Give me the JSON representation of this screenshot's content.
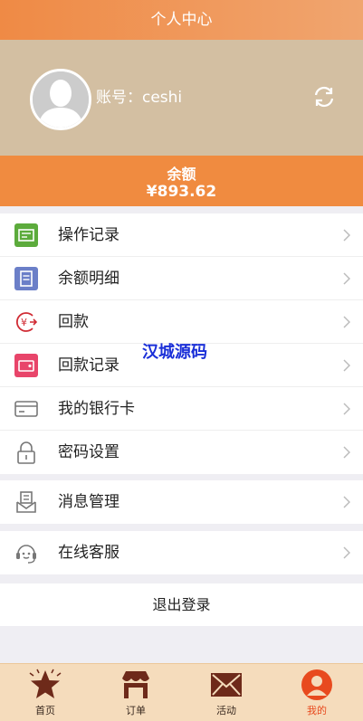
{
  "header": {
    "title": "个人中心"
  },
  "profile": {
    "account_label": "账号：ceshi"
  },
  "balance": {
    "label": "余额",
    "value": "¥893.62"
  },
  "menu_group_1": [
    {
      "label": "操作记录",
      "icon": "operation-log-icon"
    },
    {
      "label": "余额明细",
      "icon": "balance-detail-icon"
    },
    {
      "label": "回款",
      "icon": "refund-icon"
    },
    {
      "label": "回款记录",
      "icon": "refund-record-icon"
    },
    {
      "label": "我的银行卡",
      "icon": "bank-card-icon"
    },
    {
      "label": "密码设置",
      "icon": "lock-icon"
    }
  ],
  "menu_group_2": [
    {
      "label": "消息管理",
      "icon": "message-icon"
    }
  ],
  "menu_group_3": [
    {
      "label": "在线客服",
      "icon": "customer-service-icon"
    }
  ],
  "logout": {
    "label": "退出登录"
  },
  "watermark": {
    "text": "汉城源码"
  },
  "tabbar": [
    {
      "label": "首页",
      "icon": "star-icon",
      "active": false
    },
    {
      "label": "订单",
      "icon": "shop-icon",
      "active": false
    },
    {
      "label": "活动",
      "icon": "mail-icon",
      "active": false
    },
    {
      "label": "我的",
      "icon": "user-icon",
      "active": true
    }
  ],
  "colors": {
    "accent": "#f08b40",
    "profile_bg": "#d3bfa2",
    "active_tab": "#e84a1e"
  }
}
